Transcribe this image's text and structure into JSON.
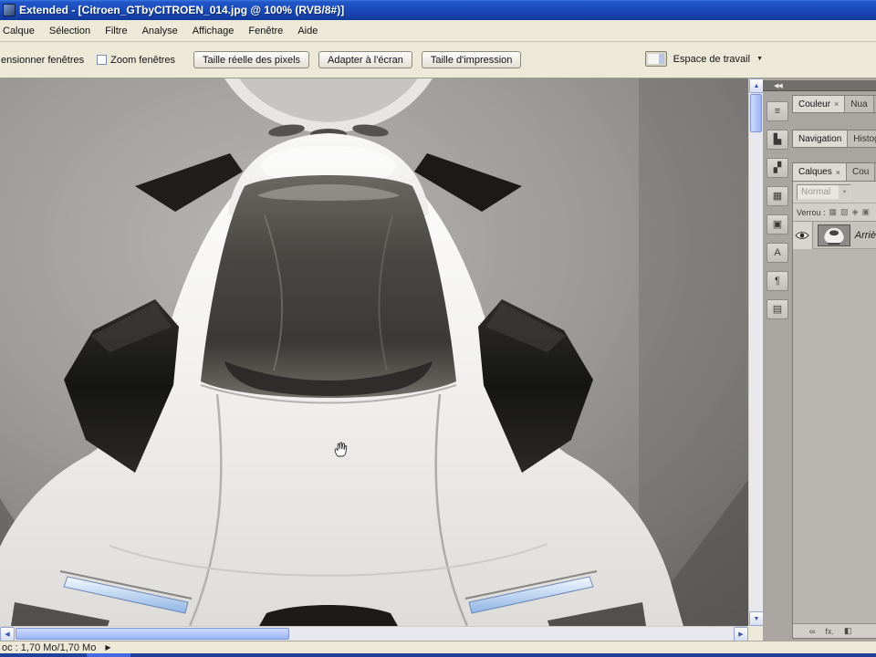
{
  "colors": {
    "titlebar_blue_top": "#3a77e0",
    "titlebar_blue_bottom": "#0f3796",
    "chrome_gray": "#ece9d8",
    "dock_gray": "#a9a6a2",
    "taskbar_navy": "#20409c"
  },
  "titlebar": {
    "title": "Extended - [Citroen_GTbyCITROEN_014.jpg @ 100% (RVB/8#)]"
  },
  "menubar": {
    "items": [
      "Calque",
      "Sélection",
      "Filtre",
      "Analyse",
      "Affichage",
      "Fenêtre",
      "Aide"
    ]
  },
  "optionsbar": {
    "resize_windows_label": "ensionner fenêtres",
    "zoom_windows_label": "Zoom fenêtres",
    "actual_pixels_button": "Taille réelle des pixels",
    "fit_screen_button": "Adapter à l'écran",
    "print_size_button": "Taille d'impression",
    "workspace_label": "Espace de travail",
    "workspace_caret": "▼"
  },
  "dock": {
    "collapse_arrows": "◀◀",
    "icon_strip": [
      {
        "name": "color-sliders-panel-icon",
        "glyph": "≡"
      },
      {
        "name": "histogram-panel-icon",
        "glyph": "▙"
      },
      {
        "name": "styles-panel-icon",
        "glyph": "▞"
      },
      {
        "name": "swatches-panel-icon",
        "glyph": "▦"
      },
      {
        "name": "clone-source-panel-icon",
        "glyph": "▣"
      },
      {
        "name": "character-panel-icon",
        "glyph": "A"
      },
      {
        "name": "paragraph-panel-icon",
        "glyph": "¶"
      },
      {
        "name": "info-panel-icon",
        "glyph": "▤"
      }
    ],
    "color_group": {
      "tab_color": "Couleur",
      "close": "×",
      "tab_swatches": "Nua"
    },
    "nav_group": {
      "tab_navigator": "Navigation",
      "tab_histogram": "Histog"
    },
    "layers_group": {
      "tab_layers": "Calques",
      "close": "×",
      "tab_channels": "Cou",
      "blend_mode": "Normal",
      "blend_caret": "▼",
      "lock_label": "Verrou :",
      "lock_icons": [
        {
          "name": "lock-transparency-icon",
          "glyph": "▦"
        },
        {
          "name": "lock-pixels-icon",
          "glyph": "▨"
        },
        {
          "name": "lock-position-icon",
          "glyph": "◈"
        },
        {
          "name": "lock-all-icon",
          "glyph": "▣"
        }
      ],
      "layer_name": "Arriè",
      "bottom_icons": [
        {
          "name": "link-layers-icon",
          "glyph": "∞"
        },
        {
          "name": "layer-style-icon",
          "glyph": "fx."
        },
        {
          "name": "layer-mask-icon",
          "glyph": "◧"
        }
      ]
    }
  },
  "scrollbars": {
    "up": "▲",
    "down": "▼",
    "left": "◀",
    "right": "▶"
  },
  "statusbar": {
    "doc_size": "oc : 1,70 Mo/1,70 Mo",
    "flyout": "▶"
  },
  "canvas": {
    "description": "White Citroën GT concept car viewed from front-top on gray studio backdrop",
    "cursor": "hand-tool"
  }
}
